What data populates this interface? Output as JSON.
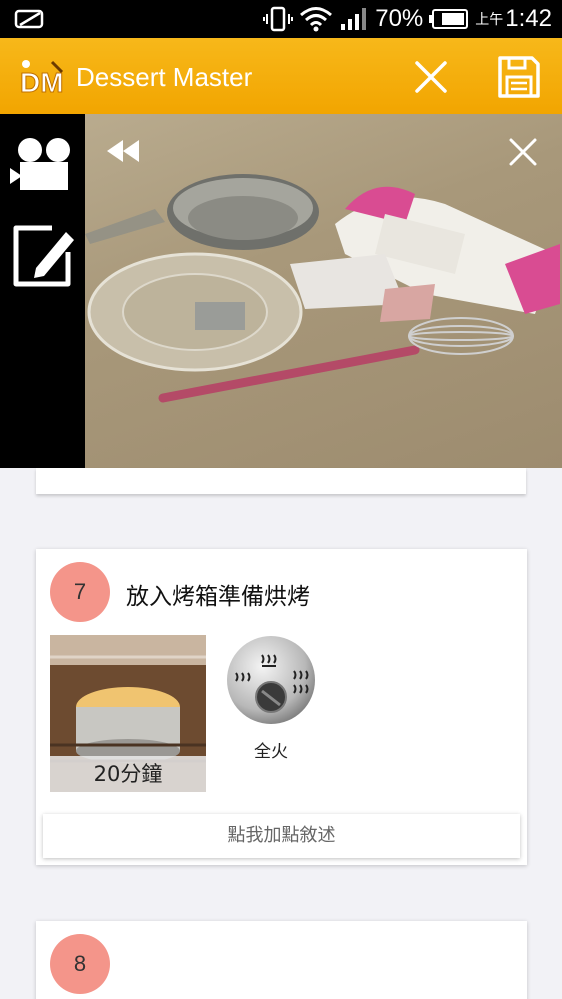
{
  "status_bar": {
    "battery_percent": "70%",
    "time_prefix": "上午",
    "time": "1:42"
  },
  "app_bar": {
    "title": "Dessert Master",
    "logo_text": "DM",
    "icons": [
      "close-icon",
      "save-icon"
    ],
    "accent_color": "#f2a500"
  },
  "overlay": {
    "side_tools": [
      "video-camera-icon",
      "edit-note-icon"
    ],
    "photo_controls": [
      "rewind-icon",
      "close-icon"
    ]
  },
  "steps": [
    {
      "number": "7",
      "title": "放入烤箱準備烘烤",
      "duration": "20分鐘",
      "heat_mode": "全火",
      "add_description_label": "點我加點敘述"
    },
    {
      "number": "8"
    }
  ],
  "colors": {
    "step_badge": "#f4958a",
    "background": "#f2f2f6"
  }
}
